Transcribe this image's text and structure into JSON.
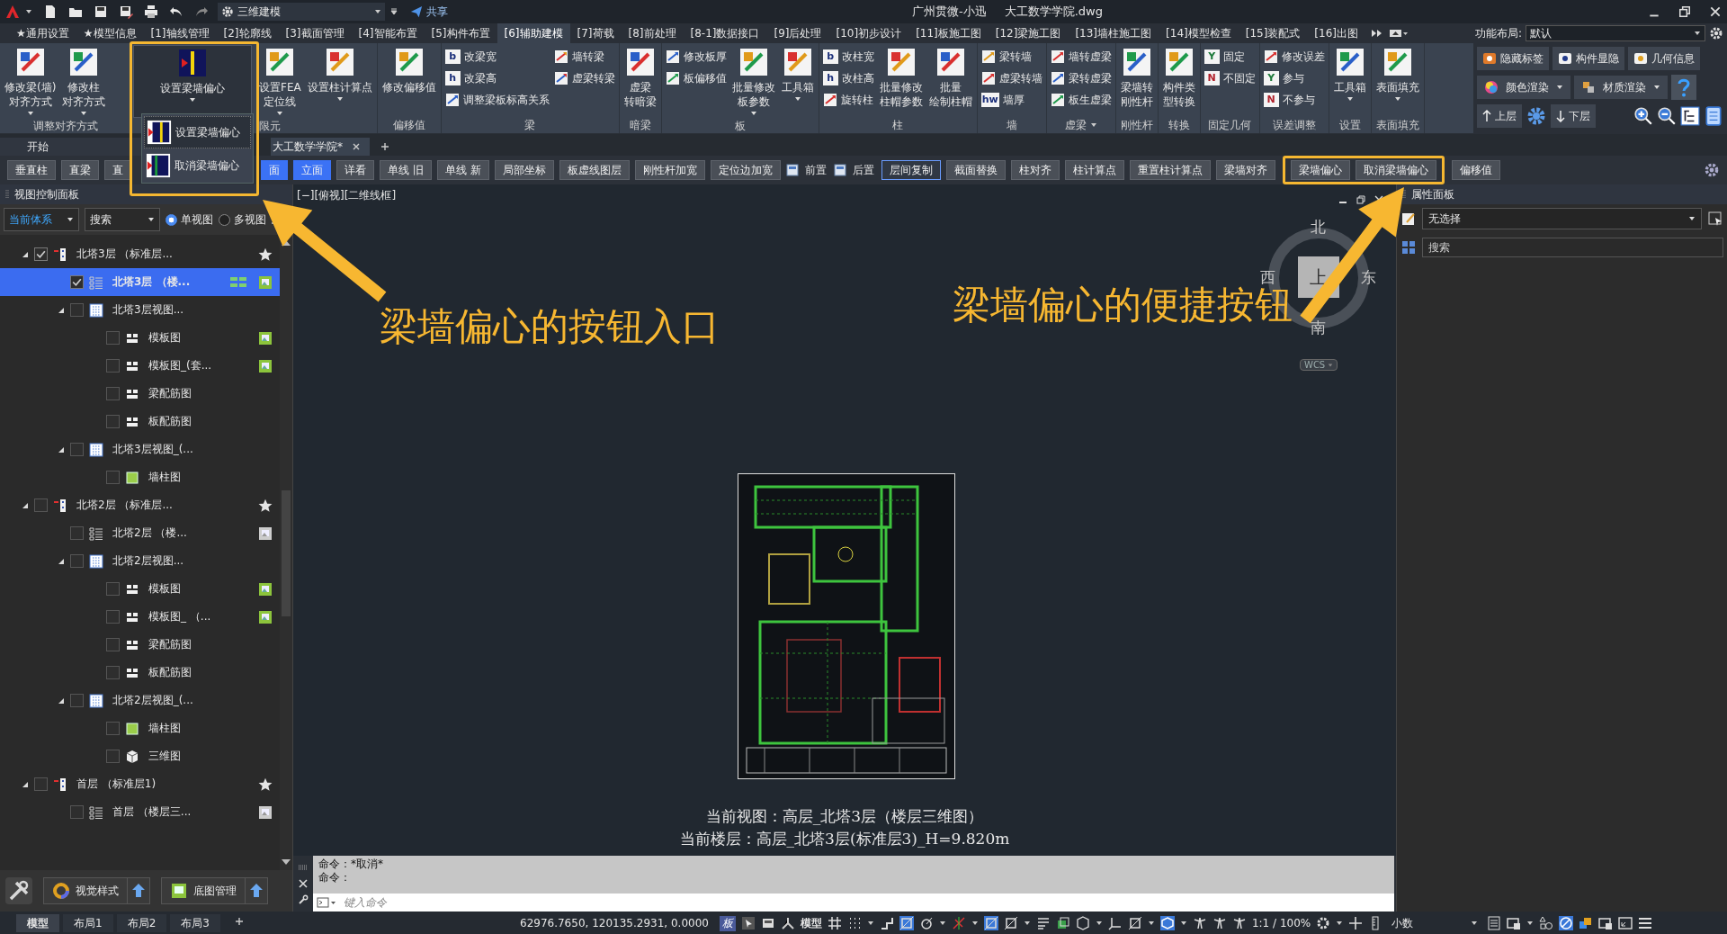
{
  "title_bar": {
    "workspace": "三维建模",
    "share": "共享",
    "title": "广州贯微-小迅",
    "file": "大工数学学院.dwg"
  },
  "ribbon_tabs": [
    {
      "label": "★通用设置",
      "selected": false
    },
    {
      "label": "★模型信息",
      "selected": false
    },
    {
      "label": "[1]轴线管理",
      "selected": false
    },
    {
      "label": "[2]轮廓线",
      "selected": false
    },
    {
      "label": "[3]截面管理",
      "selected": false
    },
    {
      "label": "[4]智能布置",
      "selected": false
    },
    {
      "label": "[5]构件布置",
      "selected": false
    },
    {
      "label": "[6]辅助建模",
      "selected": true
    },
    {
      "label": "[7]荷载",
      "selected": false
    },
    {
      "label": "[8]前处理",
      "selected": false
    },
    {
      "label": "[8-1]数据接口",
      "selected": false
    },
    {
      "label": "[9]后处理",
      "selected": false
    },
    {
      "label": "[10]初步设计",
      "selected": false
    },
    {
      "label": "[11]板施工图",
      "selected": false
    },
    {
      "label": "[12]梁施工图",
      "selected": false
    },
    {
      "label": "[13]墙柱施工图",
      "selected": false
    },
    {
      "label": "[14]模型检查",
      "selected": false
    },
    {
      "label": "[15]装配式",
      "selected": false
    },
    {
      "label": "[16]出图",
      "selected": false
    }
  ],
  "function_layout": {
    "label": "功能布局:",
    "value": "默认"
  },
  "ribbon_groups": [
    {
      "label": "调整对齐方式",
      "caret": false,
      "items": [
        {
          "kind": "large",
          "lines": [
            "修改梁(墙)",
            "对齐方式"
          ],
          "caret": true,
          "pressed": false
        },
        {
          "kind": "large",
          "lines": [
            "修改柱",
            "对齐方式"
          ],
          "caret": true,
          "pressed": false
        }
      ]
    },
    {
      "label": "限元",
      "caret": false,
      "items": [
        {
          "kind": "large",
          "lines": [
            "设置梁墙偏心"
          ],
          "caret": true,
          "pressed": true
        },
        {
          "kind": "large",
          "lines": [
            "设置FEA",
            "定位线"
          ],
          "caret": true,
          "pressed": false
        },
        {
          "kind": "large",
          "lines": [
            "设置柱计算点"
          ],
          "caret": true,
          "pressed": false
        }
      ]
    },
    {
      "label": "偏移值",
      "caret": false,
      "items": [
        {
          "kind": "large",
          "lines": [
            "修改偏移值"
          ],
          "caret": false,
          "pressed": false
        }
      ]
    },
    {
      "label": "梁",
      "caret": false,
      "items": [
        {
          "kind": "stack",
          "items": [
            {
              "label": "改梁宽",
              "glyph": "b",
              "color": "#1b2f7a"
            },
            {
              "label": "改梁高",
              "glyph": "h",
              "color": "#1b2f7a"
            },
            {
              "label": "调整梁板标高关系"
            }
          ]
        },
        {
          "kind": "stack",
          "items": [
            {
              "label": "墙转梁"
            },
            {
              "label": "虚梁转梁"
            }
          ]
        }
      ]
    },
    {
      "label": "暗梁",
      "caret": false,
      "items": [
        {
          "kind": "large",
          "lines": [
            "虚梁",
            "转暗梁"
          ],
          "caret": false,
          "pressed": false
        }
      ]
    },
    {
      "label": "板",
      "caret": false,
      "items": [
        {
          "kind": "stack",
          "items": [
            {
              "label": "修改板厚"
            },
            {
              "label": "板偏移值"
            }
          ]
        },
        {
          "kind": "large",
          "lines": [
            "批量修改",
            "板参数"
          ],
          "caret": true,
          "pressed": false
        },
        {
          "kind": "large",
          "lines": [
            "工具箱"
          ],
          "caret": true,
          "pressed": false
        }
      ]
    },
    {
      "label": "柱",
      "caret": false,
      "items": [
        {
          "kind": "stack",
          "items": [
            {
              "label": "改柱宽",
              "glyph": "b",
              "color": "#1b2f7a"
            },
            {
              "label": "改柱高",
              "glyph": "h",
              "color": "#1b2f7a"
            },
            {
              "label": "旋转柱"
            }
          ]
        },
        {
          "kind": "large",
          "lines": [
            "批量修改",
            "柱帽参数"
          ],
          "caret": false,
          "pressed": false
        },
        {
          "kind": "large",
          "lines": [
            "批量",
            "绘制柱帽"
          ],
          "caret": false,
          "pressed": false
        }
      ]
    },
    {
      "label": "墙",
      "caret": false,
      "items": [
        {
          "kind": "stack",
          "items": [
            {
              "label": "梁转墙"
            },
            {
              "label": "虚梁转墙"
            },
            {
              "label": "墙厚",
              "glyph": "hw",
              "color": "#1b2f7a"
            }
          ]
        }
      ]
    },
    {
      "label": "虚梁",
      "caret": true,
      "items": [
        {
          "kind": "stack",
          "items": [
            {
              "label": "墙转虚梁"
            },
            {
              "label": "梁转虚梁"
            },
            {
              "label": "板生虚梁"
            }
          ]
        }
      ]
    },
    {
      "label": "刚性杆",
      "caret": false,
      "items": [
        {
          "kind": "large",
          "lines": [
            "梁墙转",
            "刚性杆"
          ],
          "caret": false,
          "pressed": false
        }
      ]
    },
    {
      "label": "转换",
      "caret": false,
      "items": [
        {
          "kind": "large",
          "lines": [
            "构件类",
            "型转换"
          ],
          "caret": false,
          "pressed": false
        }
      ]
    },
    {
      "label": "固定几何",
      "caret": false,
      "items": [
        {
          "kind": "stack",
          "items": [
            {
              "label": "固定",
              "glyph": "Y",
              "color": "#1e7a3a"
            },
            {
              "label": "不固定",
              "glyph": "N",
              "color": "#b0202a"
            }
          ]
        }
      ]
    },
    {
      "label": "误差调整",
      "caret": false,
      "items": [
        {
          "kind": "stack",
          "items": [
            {
              "label": "修改误差"
            },
            {
              "label": "参与",
              "glyph": "Y",
              "color": "#1e7a3a"
            },
            {
              "label": "不参与",
              "glyph": "N",
              "color": "#b0202a"
            }
          ]
        }
      ]
    },
    {
      "label": "设置",
      "caret": false,
      "items": [
        {
          "kind": "large",
          "lines": [
            "工具箱"
          ],
          "caret": true,
          "pressed": false
        }
      ]
    },
    {
      "label": "表面填充",
      "caret": false,
      "items": [
        {
          "kind": "large",
          "lines": [
            "表面填充"
          ],
          "caret": true,
          "pressed": false
        }
      ]
    }
  ],
  "ribbon_side": {
    "row_1": [
      "隐藏标签",
      "构件显隐",
      "几何信息"
    ],
    "row_2": [
      {
        "label": "颜色渲染",
        "caret": true
      },
      {
        "label": "材质渲染",
        "caret": true
      }
    ],
    "up": "上层",
    "down": "下层"
  },
  "dropdown_menu": [
    "设置梁墙偏心",
    "取消梁墙偏心"
  ],
  "doc_tabs": {
    "start": "开始",
    "files": [
      {
        "label": "大工数学学院*",
        "selected": true
      }
    ]
  },
  "quick_toolbar": {
    "before_menu": [
      {
        "label": "垂直柱",
        "selected": false,
        "focused": false
      },
      {
        "label": "直梁",
        "selected": false,
        "focused": false
      },
      {
        "label": "直",
        "selected": false,
        "focused": false
      }
    ],
    "after_menu": [
      {
        "kind": "button",
        "label": "面",
        "selected": true,
        "focused": false
      },
      {
        "kind": "button",
        "label": "立面",
        "selected": true,
        "focused": false
      },
      {
        "kind": "button",
        "label": "详看",
        "selected": false,
        "focused": false
      },
      {
        "kind": "button",
        "label": "单线 旧",
        "selected": false,
        "focused": false
      },
      {
        "kind": "button",
        "label": "单线 新",
        "selected": false,
        "focused": false
      },
      {
        "kind": "button",
        "label": "局部坐标",
        "selected": false,
        "focused": false
      },
      {
        "kind": "button",
        "label": "板虚线图层",
        "selected": false,
        "focused": false
      },
      {
        "kind": "button",
        "label": "刚性杆加宽",
        "selected": false,
        "focused": false
      },
      {
        "kind": "button",
        "label": "定位边加宽",
        "selected": false,
        "focused": false
      },
      {
        "kind": "plain",
        "label": "前置",
        "selected": false,
        "focused": false
      },
      {
        "kind": "plain",
        "label": "后置",
        "selected": false,
        "focused": false
      },
      {
        "kind": "button",
        "label": "层间复制",
        "selected": false,
        "focused": true
      },
      {
        "kind": "button",
        "label": "截面替换",
        "selected": false,
        "focused": false
      },
      {
        "kind": "button",
        "label": "柱对齐",
        "selected": false,
        "focused": false
      },
      {
        "kind": "button",
        "label": "柱计算点",
        "selected": false,
        "focused": false
      },
      {
        "kind": "button",
        "label": "重置柱计算点",
        "selected": false,
        "focused": false
      },
      {
        "kind": "button",
        "label": "梁墙对齐",
        "selected": false,
        "focused": false
      },
      {
        "kind": "button",
        "label": "梁墙偏心",
        "selected": false,
        "focused": false
      },
      {
        "kind": "button",
        "label": "取消梁墙偏心",
        "selected": false,
        "focused": false
      },
      {
        "kind": "button",
        "label": "偏移值",
        "selected": false,
        "focused": false
      }
    ]
  },
  "left_panel": {
    "title": "视图控制面板",
    "system": "当前体系",
    "search": "搜索",
    "view_modes": [
      {
        "label": "单视图",
        "selected": true
      },
      {
        "label": "多视图",
        "selected": false
      }
    ],
    "tree": [
      {
        "label": "北塔3层 （标准层...",
        "kind": "floor",
        "favorite": true,
        "grid": false,
        "image": false,
        "checked": true,
        "selected": false,
        "expanded": true,
        "children": [
          {
            "label": "北塔3层 （楼...",
            "kind": "list",
            "favorite": false,
            "grid": true,
            "image": true,
            "image_active": true,
            "checked": true,
            "selected": true
          },
          {
            "label": "北塔3层视图...",
            "kind": "view",
            "favorite": false,
            "grid": false,
            "image": false,
            "checked": false,
            "selected": false,
            "expanded": true,
            "children": [
              {
                "label": "模板图",
                "kind": "sheet",
                "favorite": false,
                "grid": false,
                "image": true,
                "image_active": true,
                "checked": false,
                "selected": false
              },
              {
                "label": "模板图_(套...",
                "kind": "sheet",
                "favorite": false,
                "grid": false,
                "image": true,
                "image_active": true,
                "checked": false,
                "selected": false
              },
              {
                "label": "梁配筋图",
                "kind": "sheet",
                "favorite": false,
                "grid": false,
                "image": false,
                "checked": false,
                "selected": false
              },
              {
                "label": "板配筋图",
                "kind": "sheet",
                "favorite": false,
                "grid": false,
                "image": false,
                "checked": false,
                "selected": false
              }
            ]
          },
          {
            "label": "北塔3层视图_(...",
            "kind": "view",
            "favorite": false,
            "grid": false,
            "image": false,
            "checked": false,
            "selected": false,
            "expanded": true,
            "children": [
              {
                "label": "墙柱图",
                "kind": "wall",
                "favorite": false,
                "grid": false,
                "image": false,
                "checked": false,
                "selected": false
              }
            ]
          }
        ]
      },
      {
        "label": "北塔2层 （标准层...",
        "kind": "floor",
        "favorite": true,
        "grid": false,
        "image": false,
        "checked": false,
        "selected": false,
        "expanded": true,
        "children": [
          {
            "label": "北塔2层 （楼...",
            "kind": "list",
            "favorite": false,
            "grid": false,
            "image": true,
            "image_active": false,
            "checked": false,
            "selected": false
          },
          {
            "label": "北塔2层视图...",
            "kind": "view",
            "favorite": false,
            "grid": false,
            "image": false,
            "checked": false,
            "selected": false,
            "expanded": true,
            "children": [
              {
                "label": "模板图",
                "kind": "sheet",
                "favorite": false,
                "grid": false,
                "image": true,
                "image_active": true,
                "checked": false,
                "selected": false
              },
              {
                "label": "模板图_ （...",
                "kind": "sheet",
                "favorite": false,
                "grid": false,
                "image": true,
                "image_active": true,
                "checked": false,
                "selected": false
              },
              {
                "label": "梁配筋图",
                "kind": "sheet",
                "favorite": false,
                "grid": false,
                "image": false,
                "checked": false,
                "selected": false
              },
              {
                "label": "板配筋图",
                "kind": "sheet",
                "favorite": false,
                "grid": false,
                "image": false,
                "checked": false,
                "selected": false
              }
            ]
          },
          {
            "label": "北塔2层视图_(...",
            "kind": "view",
            "favorite": false,
            "grid": false,
            "image": false,
            "checked": false,
            "selected": false,
            "expanded": true,
            "children": [
              {
                "label": "墙柱图",
                "kind": "wall",
                "favorite": false,
                "grid": false,
                "image": false,
                "checked": false,
                "selected": false
              },
              {
                "label": "三维图",
                "kind": "cube",
                "favorite": false,
                "grid": false,
                "image": false,
                "checked": false,
                "selected": false
              }
            ]
          }
        ]
      },
      {
        "label": "首层 （标准层1)",
        "kind": "floor",
        "favorite": true,
        "grid": false,
        "image": false,
        "checked": false,
        "selected": false,
        "expanded": true,
        "children": [
          {
            "label": "首层 （楼层三...",
            "kind": "list",
            "favorite": false,
            "grid": false,
            "image": true,
            "image_active": false,
            "checked": false,
            "selected": false
          }
        ]
      }
    ],
    "tools": [
      "视觉样式",
      "底图管理"
    ]
  },
  "canvas": {
    "view_label": "[−][俯视][二维线框]",
    "compass": {
      "north": "北",
      "west": "西",
      "east": "东",
      "south": "南",
      "top": "上",
      "wcs": "WCS"
    },
    "captions": [
      "当前视图：高层_北塔3层（楼层三维图）",
      "当前楼层：高层_北塔3层(标准层3)_H=9.820m"
    ]
  },
  "properties": {
    "title": "属性面板",
    "selection": "无选择",
    "search": {
      "placeholder": "搜索"
    }
  },
  "command": {
    "history": [
      "命令：*取消*",
      "命令："
    ],
    "placeholder": "键入命令"
  },
  "status": {
    "layout_tabs": [
      {
        "label": "模型",
        "selected": true
      },
      {
        "label": "布局1",
        "selected": false
      },
      {
        "label": "布局2",
        "selected": false
      },
      {
        "label": "布局3",
        "selected": false
      }
    ],
    "coords": "62976.7650, 120135.2931, 0.0000",
    "badge": "板",
    "space": "模型",
    "scale": "1:1 / 100%",
    "units": "小数"
  },
  "annotations": [
    "梁墙偏心的按钮入口",
    "梁墙偏心的便捷按钮"
  ]
}
